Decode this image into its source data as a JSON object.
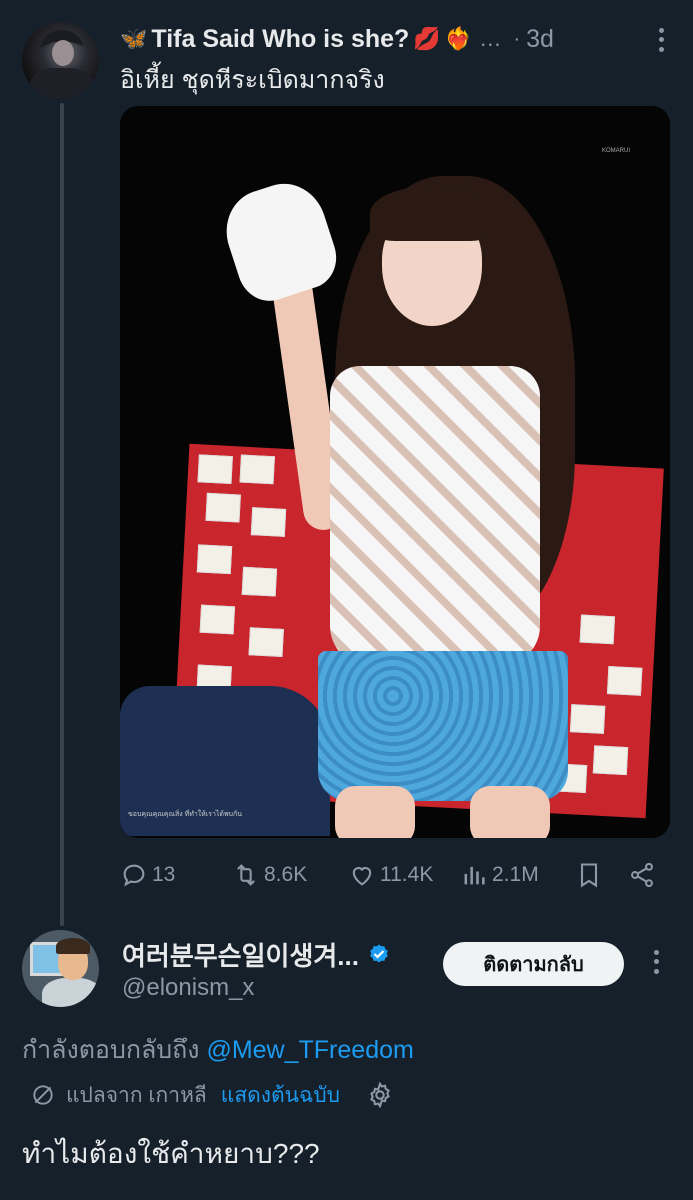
{
  "tweet": {
    "author_name": "Tifa Said Who is she?",
    "name_emojis": {
      "before": "🦋",
      "after1": "💋",
      "after2": "❤‍🔥"
    },
    "name_overflow": "...",
    "separator": "·",
    "timestamp": "3d",
    "text": "อิเหี้ย ชุดหีระเบิดมากจริง",
    "media": {
      "caption_bottom_left": "ขอบคุณคุณคุณสิ่ง ที่ทำให้เราได้พบกัน",
      "caption_top_right": "KOMARUI"
    },
    "metrics": {
      "replies": "13",
      "reposts": "8.6K",
      "likes": "11.4K",
      "views": "2.1M"
    }
  },
  "reply": {
    "author_name": "여러분무슨일이생겨...",
    "handle": "@elonism_x",
    "follow_button": "ติดตามกลับ",
    "replying_prefix": "กำลังตอบกลับถึง",
    "replying_to": "@Mew_TFreedom",
    "translated_label": "แปลจาก เกาหลี",
    "show_original": "แสดงต้นฉบับ",
    "text": "ทำไมต้องใช้คำหยาบ???"
  },
  "colors": {
    "background": "#15202b",
    "text_primary": "#e7e9ea",
    "text_secondary": "#8b98a5",
    "accent_blue": "#1d9bf0",
    "thread_line": "#38444d"
  },
  "icons": [
    "reply-icon",
    "repost-icon",
    "like-icon",
    "views-icon",
    "bookmark-icon",
    "share-icon",
    "verified-badge-icon",
    "translate-icon",
    "settings-gear-icon",
    "more-icon"
  ]
}
